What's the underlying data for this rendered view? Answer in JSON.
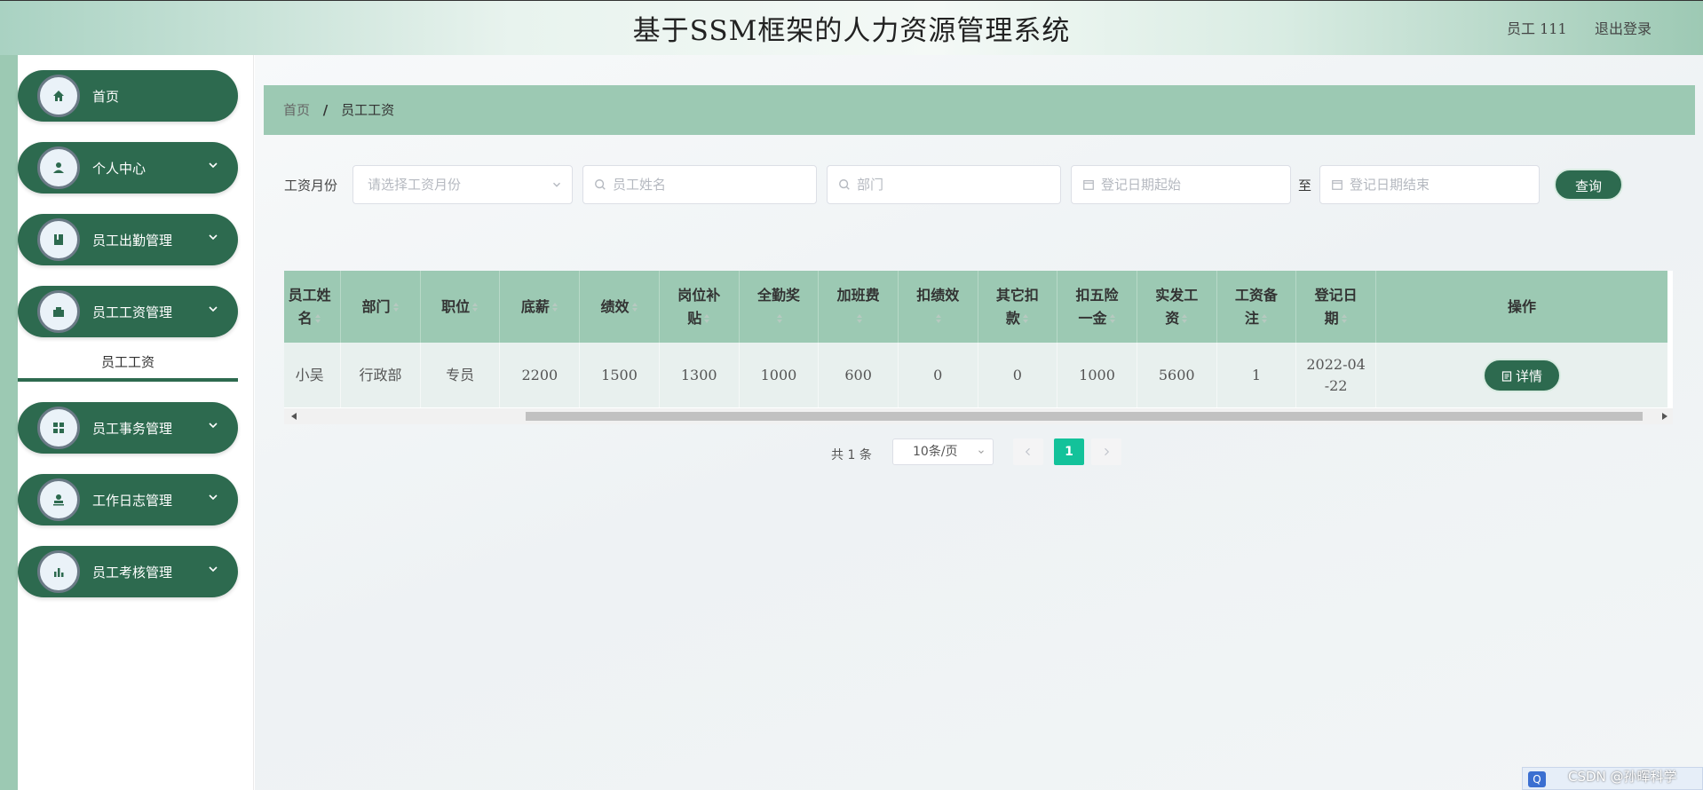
{
  "header": {
    "title": "基于SSM框架的人力资源管理系统",
    "user": "员工 111",
    "logout": "退出登录"
  },
  "sidebar": {
    "items": [
      {
        "label": "首页",
        "icon": "home-icon"
      },
      {
        "label": "个人中心",
        "icon": "person-icon"
      },
      {
        "label": "员工出勤管理",
        "icon": "book-icon"
      },
      {
        "label": "员工工资管理",
        "icon": "wallet-icon"
      },
      {
        "label": "员工事务管理",
        "icon": "grid-icon"
      },
      {
        "label": "工作日志管理",
        "icon": "stamp-icon"
      },
      {
        "label": "员工考核管理",
        "icon": "bar-chart-icon"
      }
    ],
    "submenu_active": "员工工资"
  },
  "breadcrumb": {
    "home": "首页",
    "separator": "/",
    "current": "员工工资"
  },
  "filters": {
    "month_label": "工资月份",
    "month_placeholder": "请选择工资月份",
    "name_placeholder": "员工姓名",
    "dept_placeholder": "部门",
    "start_placeholder": "登记日期起始",
    "to_label": "至",
    "end_placeholder": "登记日期结束",
    "query_button": "查询"
  },
  "table": {
    "headers": [
      [
        "员工姓",
        "名"
      ],
      [
        "部门"
      ],
      [
        "职位"
      ],
      [
        "底薪"
      ],
      [
        "绩效"
      ],
      [
        "岗位补",
        "贴"
      ],
      [
        "全勤奖"
      ],
      [
        "加班费"
      ],
      [
        "扣绩效"
      ],
      [
        "其它扣",
        "款"
      ],
      [
        "扣五险",
        "一金"
      ],
      [
        "实发工",
        "资"
      ],
      [
        "工资备",
        "注"
      ],
      [
        "登记日",
        "期"
      ],
      [
        "操作"
      ]
    ],
    "rows": [
      {
        "cells": [
          "小吴",
          "行政部",
          "专员",
          "2200",
          "1500",
          "1300",
          "1000",
          "600",
          "0",
          "0",
          "1000",
          "5600",
          "1"
        ],
        "date_line1": "2022-04",
        "date_line2": "-22",
        "action": "详情"
      }
    ]
  },
  "pagination": {
    "total_prefix": "共",
    "total": "1",
    "total_suffix": "条",
    "page_size": "10条/页",
    "current_page": "1"
  },
  "watermark": "CSDN @孙晖科学",
  "colors": {
    "primary": "#2d6a4f",
    "header_row": "#9cc9b3",
    "active_page": "#13c29a"
  }
}
